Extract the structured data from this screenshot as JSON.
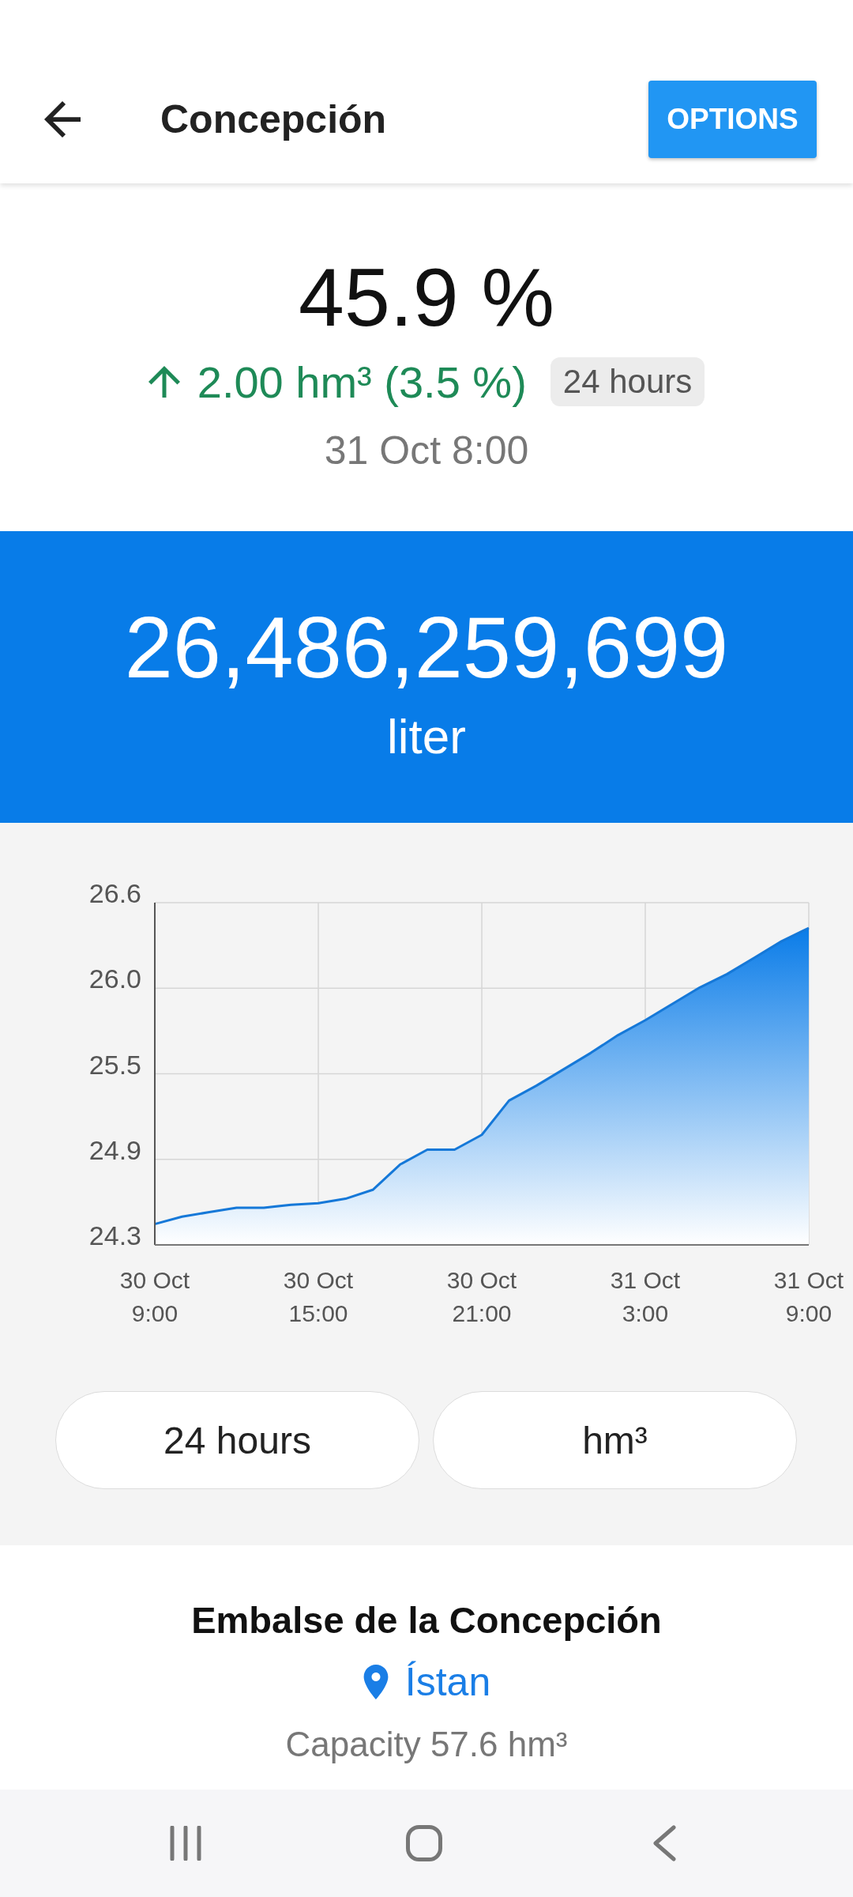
{
  "app_bar": {
    "title": "Concepción",
    "options_button": "OPTIONS"
  },
  "summary": {
    "percent": "45.9 %",
    "change": {
      "increasing": true,
      "text": "2.00 hm³ (3.5 %)"
    },
    "period_badge": "24 hours",
    "timestamp": "31 Oct 8:00"
  },
  "volume_banner": {
    "value": "26,486,259,699",
    "unit": "liter"
  },
  "chart": {
    "chart_data": {
      "type": "area",
      "grid": true,
      "categories": [
        "30 Oct 9:00",
        null,
        null,
        null,
        null,
        null,
        "30 Oct 15:00",
        null,
        null,
        null,
        null,
        null,
        "30 Oct 21:00",
        null,
        null,
        null,
        null,
        null,
        "31 Oct 3:00",
        null,
        null,
        null,
        null,
        null,
        "31 Oct 9:00"
      ],
      "values": [
        24.44,
        24.49,
        24.52,
        24.55,
        24.55,
        24.57,
        24.58,
        24.61,
        24.67,
        24.84,
        24.94,
        24.94,
        25.04,
        25.27,
        25.37,
        25.48,
        25.59,
        25.71,
        25.81,
        25.92,
        26.03,
        26.12,
        26.23,
        26.34,
        26.43
      ],
      "ylim": [
        24.3,
        26.6
      ],
      "yticks": [
        {
          "value": 24.3,
          "label": "24.3"
        },
        {
          "value": 24.875,
          "label": "24.9"
        },
        {
          "value": 25.45,
          "label": "25.5"
        },
        {
          "value": 26.025,
          "label": "26.0"
        },
        {
          "value": 26.6,
          "label": "26.6"
        }
      ]
    }
  },
  "controls": [
    "24 hours",
    "hm³"
  ],
  "reservoir": {
    "name": "Embalse de la Concepción",
    "location": "Ístan",
    "capacity": "Capacity 57.6 hm³"
  }
}
